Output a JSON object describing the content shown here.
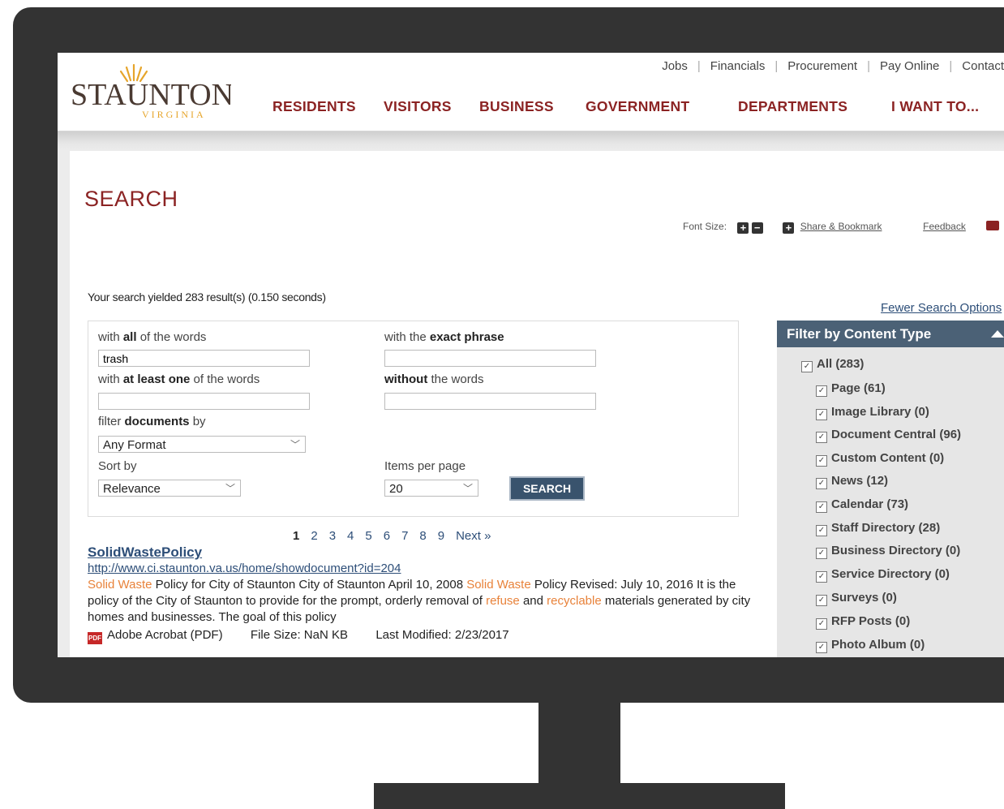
{
  "logo": {
    "name": "STAUNTON",
    "state": "VIRGINIA"
  },
  "utility_nav": [
    "Jobs",
    "Financials",
    "Procurement",
    "Pay Online",
    "Contact"
  ],
  "main_nav": [
    "RESIDENTS",
    "VISITORS",
    "BUSINESS",
    "GOVERNMENT",
    "DEPARTMENTS",
    "I WANT TO..."
  ],
  "page": {
    "title": "SEARCH"
  },
  "tools": {
    "font_size_label": "Font Size:",
    "share": "Share & Bookmark",
    "feedback": "Feedback"
  },
  "result_count": "Your search yielded 283 result(s) (0.150 seconds)",
  "form": {
    "all_words_pre": "with ",
    "all_words_bold": "all",
    "all_words_post": " of the words",
    "all_words_value": "trash",
    "exact_pre": "with the ",
    "exact_bold": "exact phrase",
    "exact_value": "",
    "least_one_pre": "with ",
    "least_one_bold": "at least one",
    "least_one_post": " of the words",
    "least_one_value": "",
    "without_bold": "without",
    "without_post": " the words",
    "without_value": "",
    "filter_pre": "filter ",
    "filter_bold": "documents",
    "filter_post": " by",
    "filter_value": "Any Format",
    "sort_label": "Sort by",
    "sort_value": "Relevance",
    "items_label": "Items per page",
    "items_value": "20",
    "search_button": "SEARCH"
  },
  "pager": {
    "current": "1",
    "pages": [
      "2",
      "3",
      "4",
      "5",
      "6",
      "7",
      "8",
      "9"
    ],
    "next": "Next »"
  },
  "result": {
    "title": "SolidWastePolicy",
    "url": "http://www.ci.staunton.va.us/home/showdocument?id=204",
    "snippet": [
      {
        "t": "Solid Waste",
        "h": true
      },
      {
        "t": " Policy for City of Staunton City of Staunton April 10, 2008 ",
        "h": false
      },
      {
        "t": "Solid Waste",
        "h": true
      },
      {
        "t": " Policy Revised: July 10, 2016 It is the policy of the City of Staunton to provide for the prompt, orderly removal of ",
        "h": false
      },
      {
        "t": "refuse",
        "h": true
      },
      {
        "t": " and ",
        "h": false
      },
      {
        "t": "recyclable",
        "h": true
      },
      {
        "t": " materials generated by city homes and businesses. The goal of this policy",
        "h": false
      }
    ],
    "format": "Adobe Acrobat (PDF)",
    "file_size": "File Size: NaN KB",
    "last_modified": "Last Modified: 2/23/2017"
  },
  "sidebar": {
    "fewer": "Fewer Search Options",
    "header": "Filter by Content Type",
    "items": [
      {
        "label": "All (283)"
      },
      {
        "label": "Page (61)"
      },
      {
        "label": "Image Library (0)"
      },
      {
        "label": "Document Central (96)"
      },
      {
        "label": "Custom Content (0)"
      },
      {
        "label": "News (12)"
      },
      {
        "label": "Calendar (73)"
      },
      {
        "label": "Staff Directory (28)"
      },
      {
        "label": "Business Directory (0)"
      },
      {
        "label": "Service Directory (0)"
      },
      {
        "label": "Surveys (0)"
      },
      {
        "label": "RFP Posts (0)"
      },
      {
        "label": "Photo Album (0)"
      }
    ]
  },
  "colors": {
    "brand": "#8b2323",
    "link": "#2d4e78",
    "highlight": "#e8823a",
    "bezel": "#333333",
    "sidebar_header": "#4b6176"
  }
}
